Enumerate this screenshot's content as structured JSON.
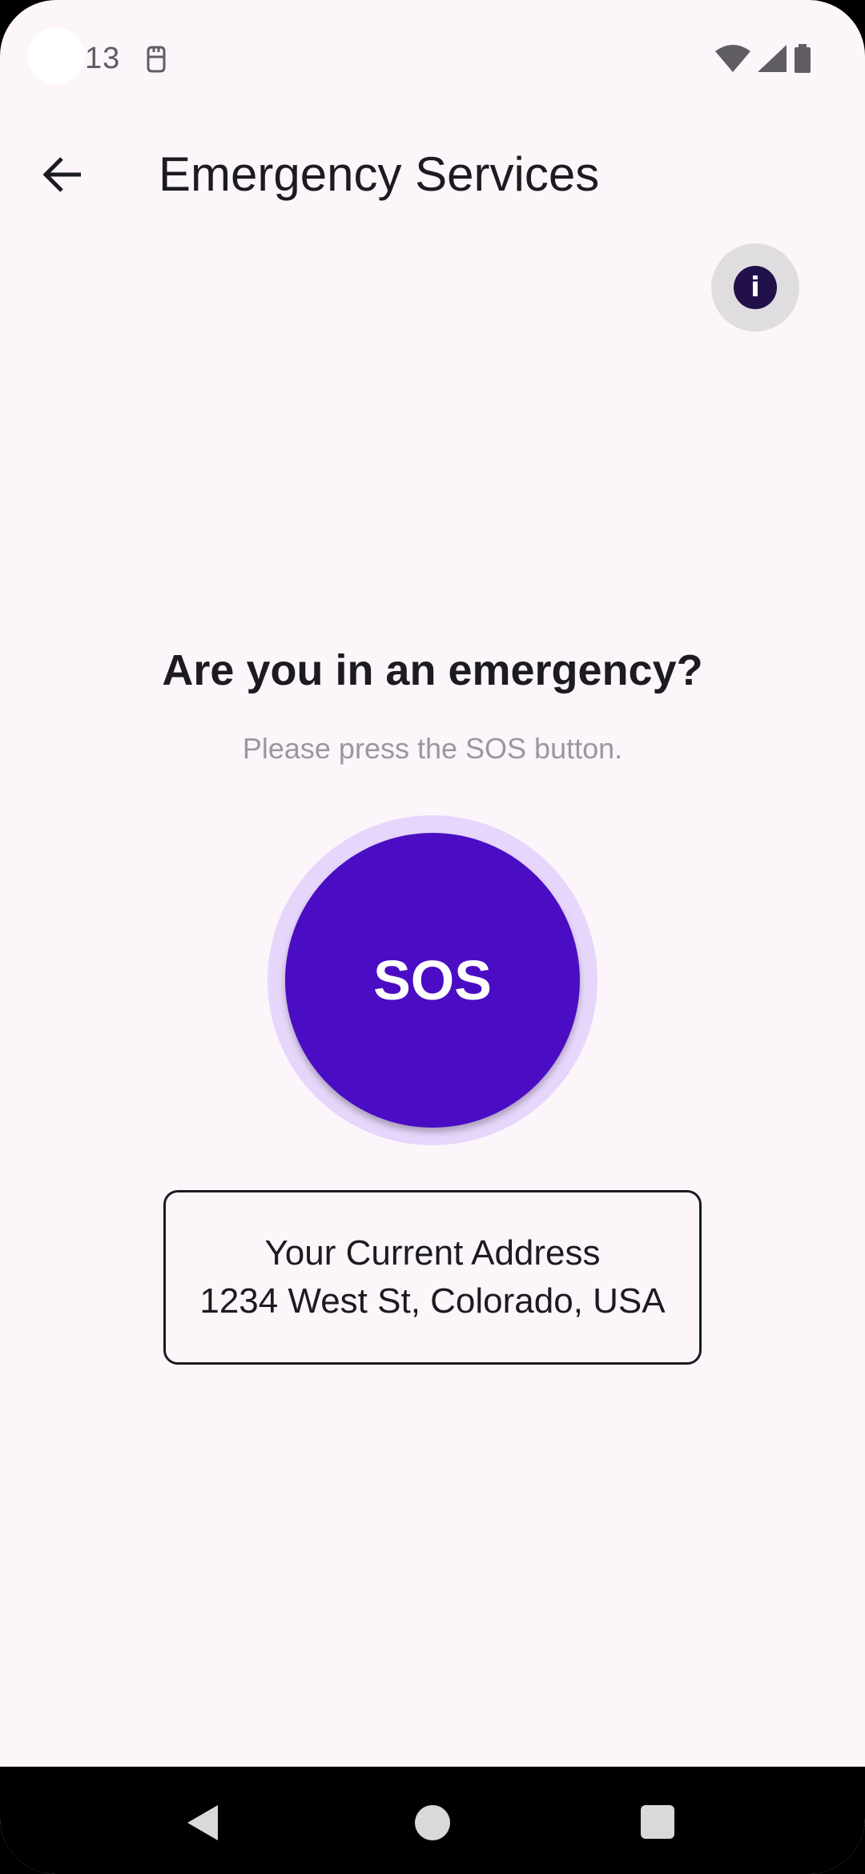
{
  "status_bar": {
    "time": "13",
    "notification_icon": "notification-icon",
    "icons": [
      "wifi-icon",
      "signal-icon",
      "battery-icon"
    ]
  },
  "app_bar": {
    "title": "Emergency Services",
    "back_icon": "back-arrow-icon"
  },
  "info_button": {
    "label": "i",
    "icon": "info-icon"
  },
  "main": {
    "question": "Are you in an emergency?",
    "instruction": "Please press the SOS button.",
    "sos_label": "SOS",
    "address_label": "Your Current Address",
    "address_value": "1234 West St, Colorado, USA"
  },
  "nav_bar": {
    "buttons": [
      "back-icon",
      "home-icon",
      "recents-icon"
    ]
  },
  "colors": {
    "background": "#fcf6fb",
    "sos": "#4a0dc3",
    "sos_ring": "#e7d6fb",
    "info": "#21104a"
  }
}
